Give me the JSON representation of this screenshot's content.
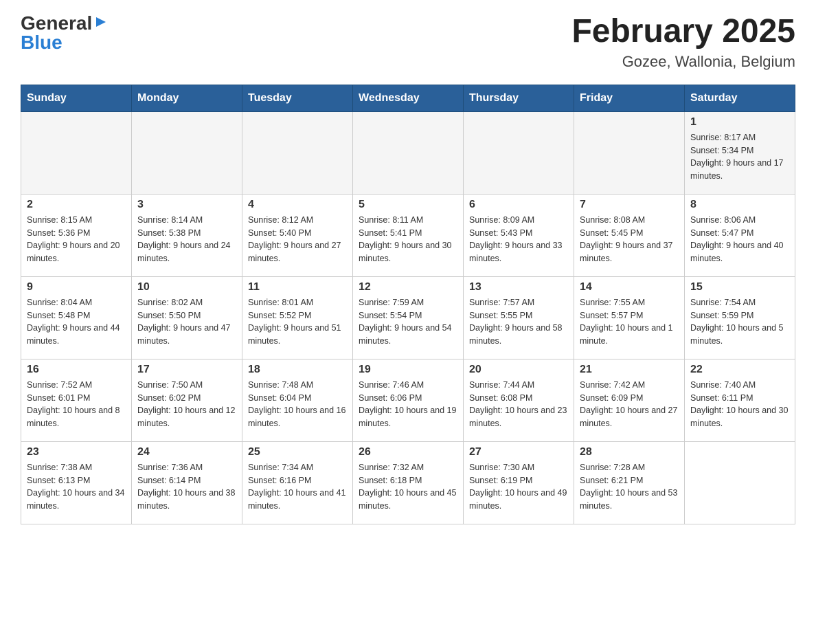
{
  "header": {
    "logo": {
      "general": "General",
      "triangle": "▶",
      "blue": "Blue"
    },
    "title": "February 2025",
    "location": "Gozee, Wallonia, Belgium"
  },
  "days_of_week": [
    "Sunday",
    "Monday",
    "Tuesday",
    "Wednesday",
    "Thursday",
    "Friday",
    "Saturday"
  ],
  "weeks": [
    [
      {
        "day": "",
        "info": ""
      },
      {
        "day": "",
        "info": ""
      },
      {
        "day": "",
        "info": ""
      },
      {
        "day": "",
        "info": ""
      },
      {
        "day": "",
        "info": ""
      },
      {
        "day": "",
        "info": ""
      },
      {
        "day": "1",
        "info": "Sunrise: 8:17 AM\nSunset: 5:34 PM\nDaylight: 9 hours and 17 minutes."
      }
    ],
    [
      {
        "day": "2",
        "info": "Sunrise: 8:15 AM\nSunset: 5:36 PM\nDaylight: 9 hours and 20 minutes."
      },
      {
        "day": "3",
        "info": "Sunrise: 8:14 AM\nSunset: 5:38 PM\nDaylight: 9 hours and 24 minutes."
      },
      {
        "day": "4",
        "info": "Sunrise: 8:12 AM\nSunset: 5:40 PM\nDaylight: 9 hours and 27 minutes."
      },
      {
        "day": "5",
        "info": "Sunrise: 8:11 AM\nSunset: 5:41 PM\nDaylight: 9 hours and 30 minutes."
      },
      {
        "day": "6",
        "info": "Sunrise: 8:09 AM\nSunset: 5:43 PM\nDaylight: 9 hours and 33 minutes."
      },
      {
        "day": "7",
        "info": "Sunrise: 8:08 AM\nSunset: 5:45 PM\nDaylight: 9 hours and 37 minutes."
      },
      {
        "day": "8",
        "info": "Sunrise: 8:06 AM\nSunset: 5:47 PM\nDaylight: 9 hours and 40 minutes."
      }
    ],
    [
      {
        "day": "9",
        "info": "Sunrise: 8:04 AM\nSunset: 5:48 PM\nDaylight: 9 hours and 44 minutes."
      },
      {
        "day": "10",
        "info": "Sunrise: 8:02 AM\nSunset: 5:50 PM\nDaylight: 9 hours and 47 minutes."
      },
      {
        "day": "11",
        "info": "Sunrise: 8:01 AM\nSunset: 5:52 PM\nDaylight: 9 hours and 51 minutes."
      },
      {
        "day": "12",
        "info": "Sunrise: 7:59 AM\nSunset: 5:54 PM\nDaylight: 9 hours and 54 minutes."
      },
      {
        "day": "13",
        "info": "Sunrise: 7:57 AM\nSunset: 5:55 PM\nDaylight: 9 hours and 58 minutes."
      },
      {
        "day": "14",
        "info": "Sunrise: 7:55 AM\nSunset: 5:57 PM\nDaylight: 10 hours and 1 minute."
      },
      {
        "day": "15",
        "info": "Sunrise: 7:54 AM\nSunset: 5:59 PM\nDaylight: 10 hours and 5 minutes."
      }
    ],
    [
      {
        "day": "16",
        "info": "Sunrise: 7:52 AM\nSunset: 6:01 PM\nDaylight: 10 hours and 8 minutes."
      },
      {
        "day": "17",
        "info": "Sunrise: 7:50 AM\nSunset: 6:02 PM\nDaylight: 10 hours and 12 minutes."
      },
      {
        "day": "18",
        "info": "Sunrise: 7:48 AM\nSunset: 6:04 PM\nDaylight: 10 hours and 16 minutes."
      },
      {
        "day": "19",
        "info": "Sunrise: 7:46 AM\nSunset: 6:06 PM\nDaylight: 10 hours and 19 minutes."
      },
      {
        "day": "20",
        "info": "Sunrise: 7:44 AM\nSunset: 6:08 PM\nDaylight: 10 hours and 23 minutes."
      },
      {
        "day": "21",
        "info": "Sunrise: 7:42 AM\nSunset: 6:09 PM\nDaylight: 10 hours and 27 minutes."
      },
      {
        "day": "22",
        "info": "Sunrise: 7:40 AM\nSunset: 6:11 PM\nDaylight: 10 hours and 30 minutes."
      }
    ],
    [
      {
        "day": "23",
        "info": "Sunrise: 7:38 AM\nSunset: 6:13 PM\nDaylight: 10 hours and 34 minutes."
      },
      {
        "day": "24",
        "info": "Sunrise: 7:36 AM\nSunset: 6:14 PM\nDaylight: 10 hours and 38 minutes."
      },
      {
        "day": "25",
        "info": "Sunrise: 7:34 AM\nSunset: 6:16 PM\nDaylight: 10 hours and 41 minutes."
      },
      {
        "day": "26",
        "info": "Sunrise: 7:32 AM\nSunset: 6:18 PM\nDaylight: 10 hours and 45 minutes."
      },
      {
        "day": "27",
        "info": "Sunrise: 7:30 AM\nSunset: 6:19 PM\nDaylight: 10 hours and 49 minutes."
      },
      {
        "day": "28",
        "info": "Sunrise: 7:28 AM\nSunset: 6:21 PM\nDaylight: 10 hours and 53 minutes."
      },
      {
        "day": "",
        "info": ""
      }
    ]
  ]
}
